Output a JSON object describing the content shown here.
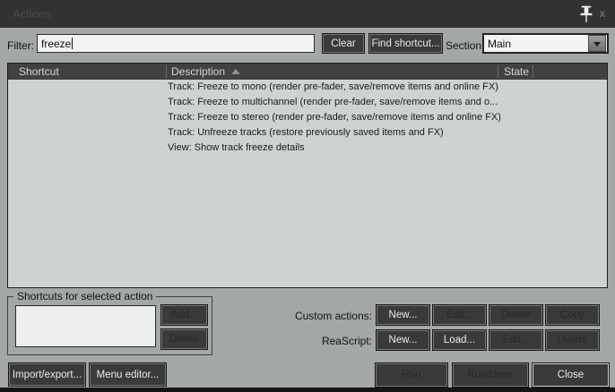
{
  "window": {
    "title": "Actions"
  },
  "icons": {
    "pin": "pushpin",
    "close": "x",
    "sort": "ascending-triangle",
    "dropdown": "down-triangle"
  },
  "filter": {
    "label": "Filter:",
    "value": "freeze",
    "clear_label": "Clear",
    "find_shortcut_label": "Find shortcut...",
    "section_label": "Section:",
    "section_value": "Main"
  },
  "table": {
    "columns": [
      "Shortcut",
      "Description",
      "State",
      ""
    ],
    "sorted_by": "Description",
    "sort_direction": "ascending",
    "rows": [
      {
        "shortcut": "",
        "description": "Track: Freeze to mono (render pre-fader, save/remove items and online FX)",
        "state": ""
      },
      {
        "shortcut": "",
        "description": "Track: Freeze to multichannel (render pre-fader, save/remove items and o...",
        "state": ""
      },
      {
        "shortcut": "",
        "description": "Track: Freeze to stereo (render pre-fader, save/remove items and online FX)",
        "state": ""
      },
      {
        "shortcut": "",
        "description": "Track: Unfreeze tracks (restore previously saved items and FX)",
        "state": ""
      },
      {
        "shortcut": "",
        "description": "View: Show track freeze details",
        "state": ""
      }
    ]
  },
  "shortcuts_group": {
    "title": "Shortcuts for selected action",
    "add_label": "Add...",
    "delete_label": "Delete"
  },
  "custom_actions": {
    "label": "Custom actions:",
    "new_label": "New...",
    "edit_label": "Edit...",
    "delete_label": "Delete",
    "copy_label": "Copy"
  },
  "reascript": {
    "label": "ReaScript:",
    "new_label": "New...",
    "load_label": "Load...",
    "edit_label": "Edit...",
    "delete_label": "Delete"
  },
  "footer": {
    "import_export_label": "Import/export...",
    "menu_editor_label": "Menu editor...",
    "run_label": "Run",
    "run_close_label": "Run/close",
    "close_label": "Close"
  },
  "colors": {
    "titlebar_bg": "#323234",
    "dialog_bg": "#a4a8a5",
    "button_bg": "#3a3a3c",
    "table_bg": "#cfd3d0",
    "table_header_bg": "#414144",
    "field_bg": "#f2f3f2"
  }
}
